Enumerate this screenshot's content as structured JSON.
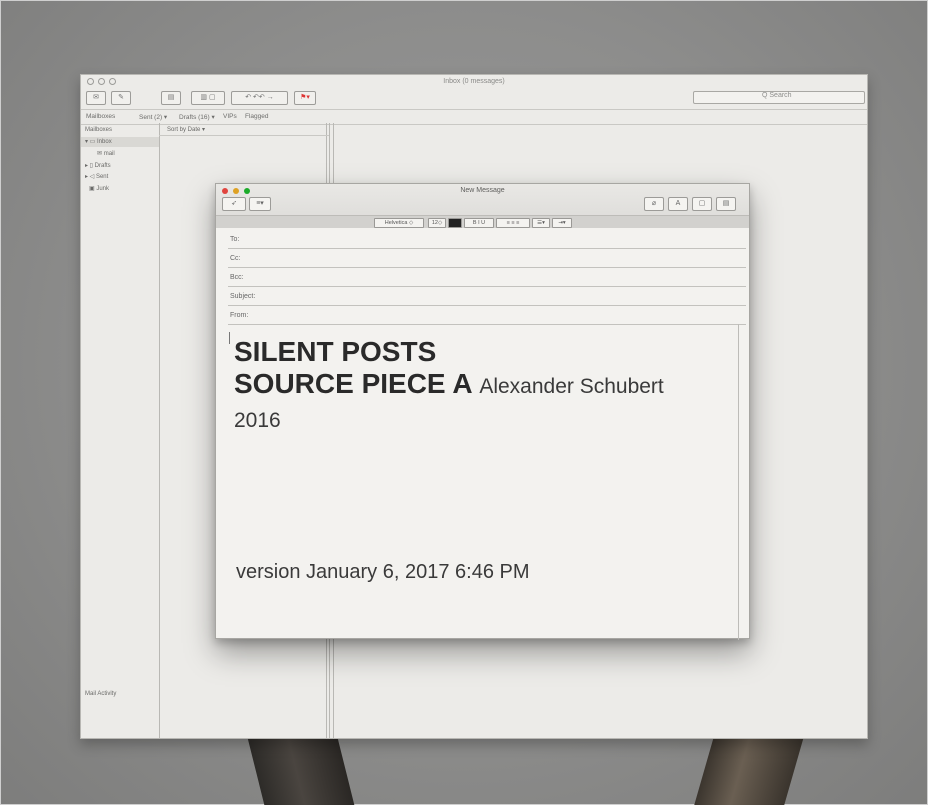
{
  "mail_window": {
    "title": "Inbox (0 messages)",
    "search_placeholder": "Q Search",
    "favorites": [
      "Mailboxes",
      "Sent (2) ▾",
      "Drafts (16) ▾",
      "VIPs",
      "Flagged"
    ],
    "sidebar": {
      "header": "Mailboxes",
      "items": [
        "Inbox",
        "mail",
        "Drafts",
        "Sent",
        "Junk"
      ],
      "activity": "Mail Activity",
      "bottom_icons": "+ ☐ ✿"
    },
    "list_header": "Sort by Date ▾"
  },
  "compose": {
    "title": "New Message",
    "font": "Helvetica",
    "size": "12",
    "fields": [
      "To:",
      "Cc:",
      "Bcc:",
      "Subject:",
      "From:"
    ],
    "body": {
      "line1": "SILENT POSTS",
      "line2": "SOURCE PIECE A",
      "author": "Alexander Schubert",
      "year": "2016",
      "version": "version January 6, 2017 6:46 PM"
    }
  },
  "colors": {
    "light_close": "#e0443e",
    "light_min": "#dea123",
    "light_max": "#1aab29"
  }
}
